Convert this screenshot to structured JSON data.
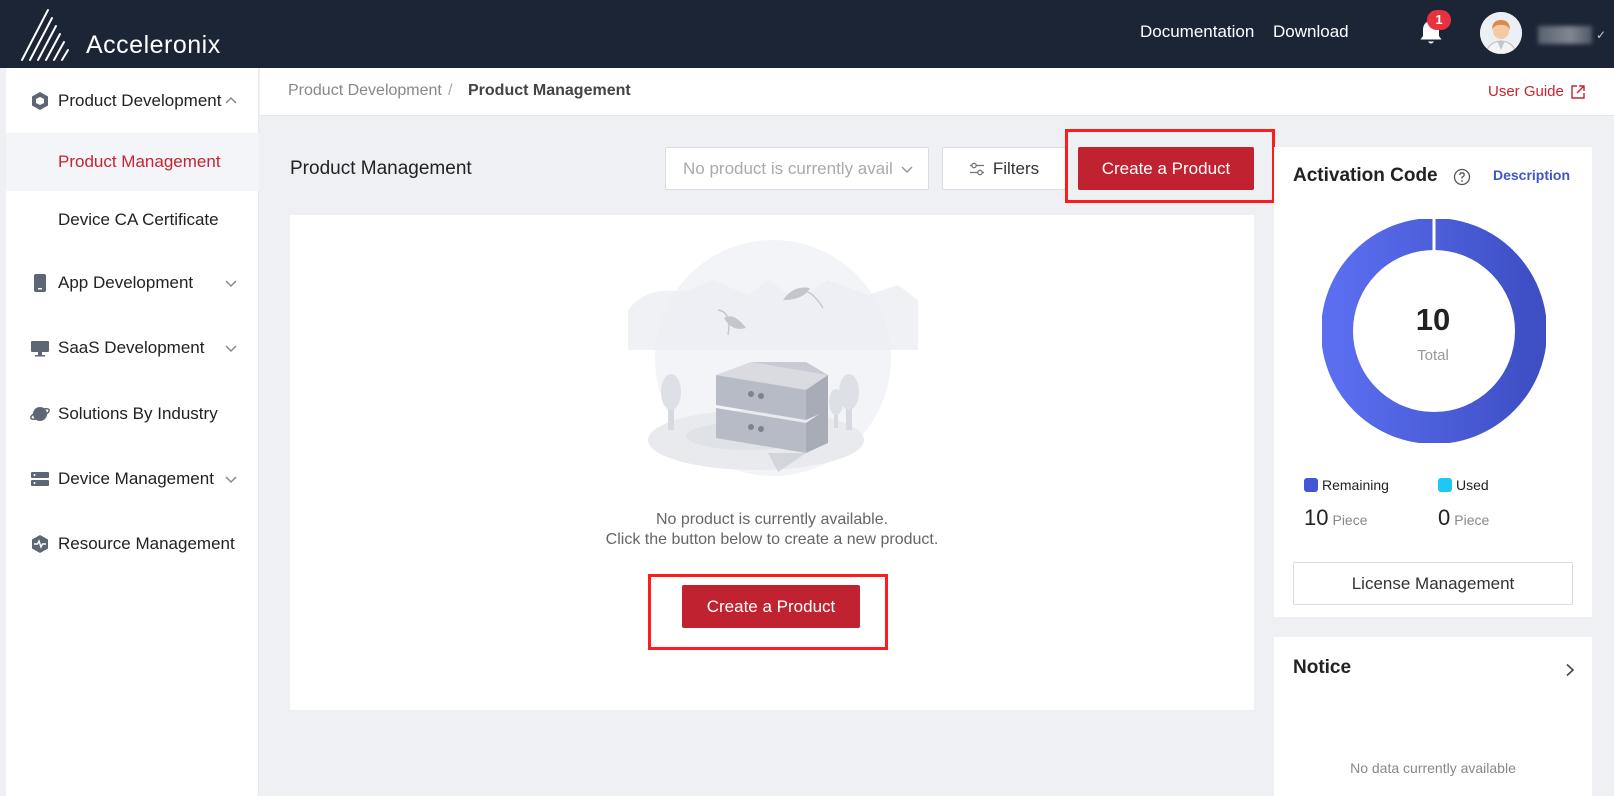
{
  "header": {
    "brand": "Acceleronix",
    "links": {
      "documentation": "Documentation",
      "download": "Download"
    },
    "notifications_count": "1"
  },
  "sidebar": {
    "items": [
      {
        "label": "Product Development",
        "icon": "cube-icon",
        "expanded": true
      },
      {
        "label": "Product Management",
        "active": true
      },
      {
        "label": "Device CA Certificate"
      },
      {
        "label": "App Development",
        "icon": "mobile-icon"
      },
      {
        "label": "SaaS Development",
        "icon": "monitor-icon"
      },
      {
        "label": "Solutions By Industry",
        "icon": "globe-icon"
      },
      {
        "label": "Device Management",
        "icon": "server-icon"
      },
      {
        "label": "Resource Management",
        "icon": "pulse-icon"
      }
    ]
  },
  "breadcrumb": {
    "parent": "Product Development",
    "separator": "/",
    "current": "Product Management",
    "user_guide": "User Guide"
  },
  "main": {
    "title": "Product Management",
    "product_select_placeholder": "No product is currently avail",
    "filters_label": "Filters",
    "create_label": "Create a Product",
    "empty_line1": "No product is currently available.",
    "empty_line2": "Click the button below to create a new product.",
    "empty_create_label": "Create a Product"
  },
  "activation": {
    "title": "Activation Code",
    "description_link": "Description",
    "total": "10",
    "total_label": "Total",
    "remaining_label": "Remaining",
    "remaining_value": "10",
    "used_label": "Used",
    "used_value": "0",
    "unit": "Piece",
    "license_button": "License Management",
    "colors": {
      "remaining": "#4456d6",
      "used": "#1ec8f0"
    }
  },
  "notice": {
    "title": "Notice",
    "empty": "No data currently available"
  },
  "colors": {
    "topbar": "#1c2536",
    "primary_red": "#c0222f",
    "active_text": "#c8232f",
    "accent_blue": "#3f56c9"
  }
}
